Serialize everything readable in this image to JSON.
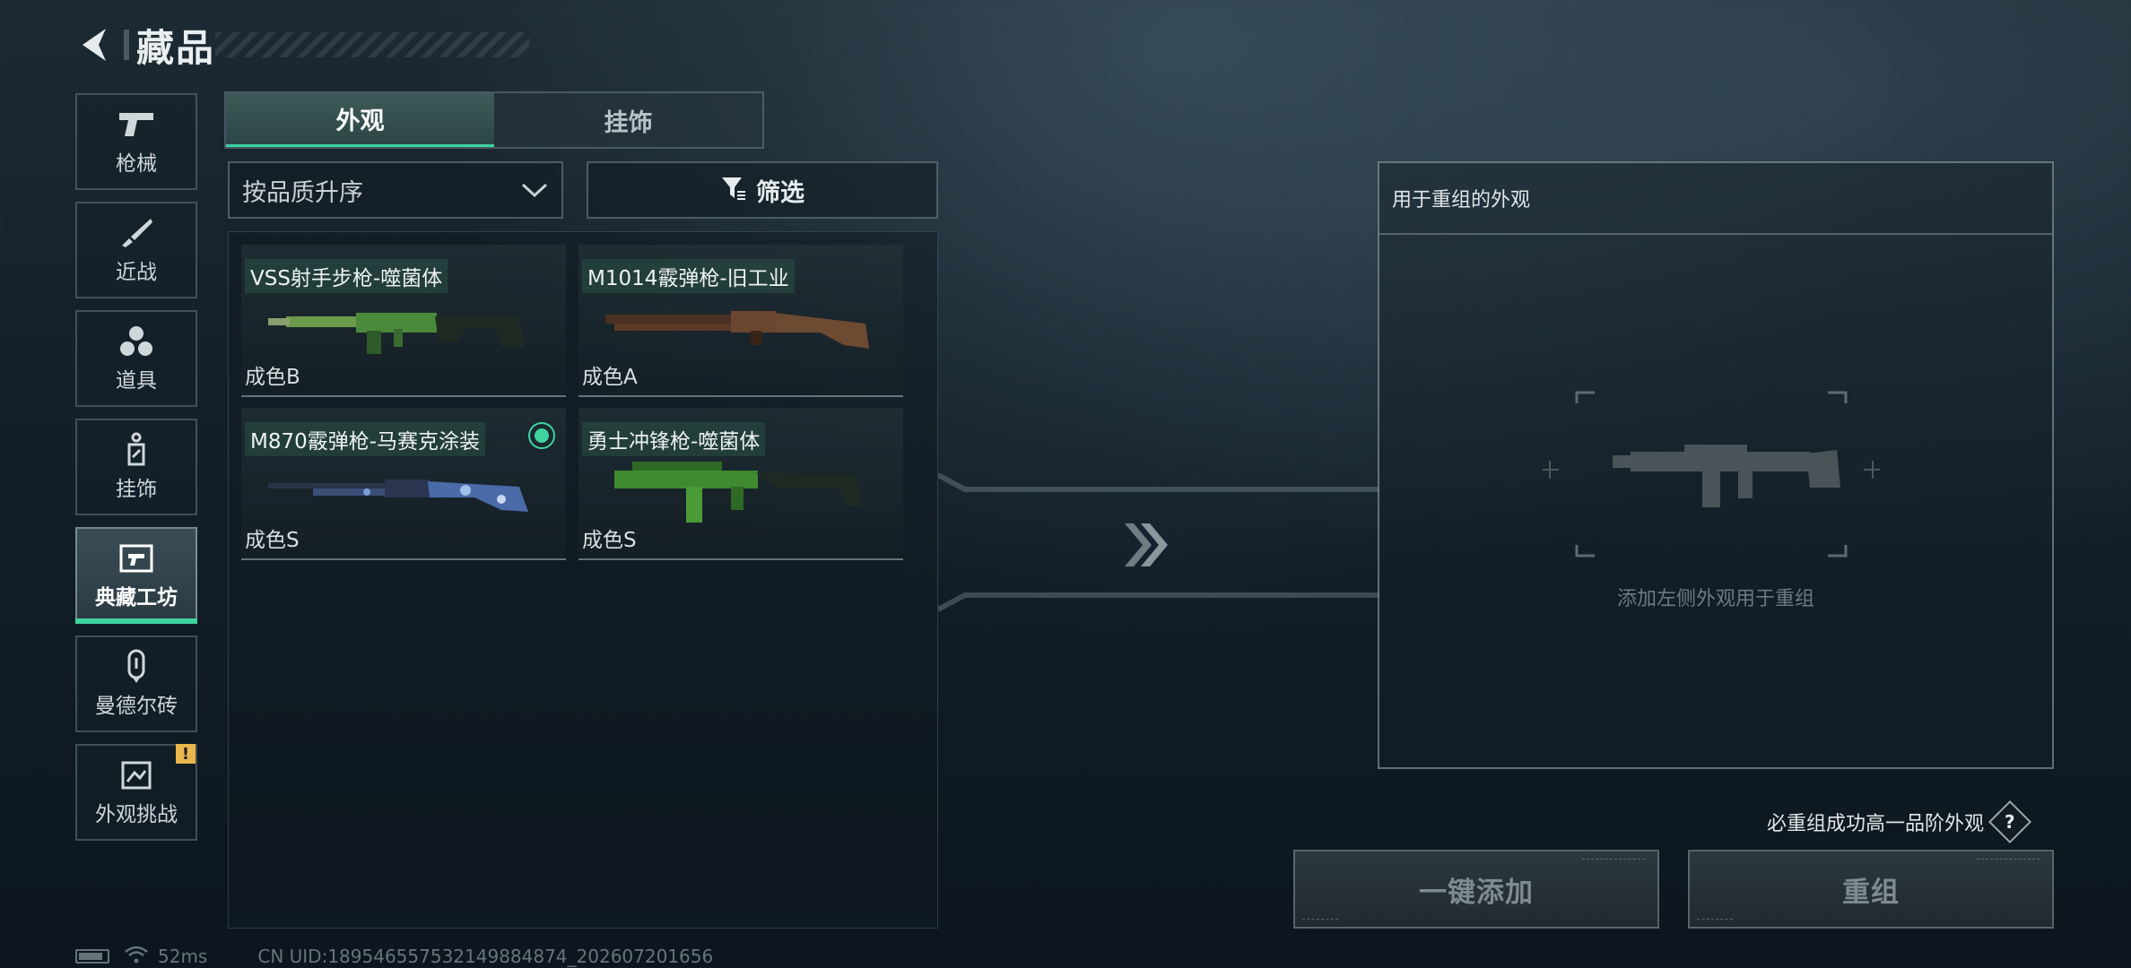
{
  "header": {
    "title": "藏品"
  },
  "sidebar": {
    "items": [
      {
        "label": "枪械",
        "icon": "pistol-icon"
      },
      {
        "label": "近战",
        "icon": "knife-icon"
      },
      {
        "label": "道具",
        "icon": "grenade-cluster-icon"
      },
      {
        "label": "挂饰",
        "icon": "charm-tag-icon"
      },
      {
        "label": "典藏工坊",
        "icon": "workshop-icon",
        "active": true
      },
      {
        "label": "曼德尔砖",
        "icon": "mandel-brick-icon"
      },
      {
        "label": "外观挑战",
        "icon": "skin-challenge-icon",
        "badge": "!"
      }
    ]
  },
  "tabs": [
    {
      "label": "外观",
      "active": true
    },
    {
      "label": "挂饰",
      "active": false
    }
  ],
  "sort": {
    "value": "按品质升序"
  },
  "filter": {
    "label": "筛选"
  },
  "items": [
    {
      "name": "VSS射手步枪-噬菌体",
      "grade": "成色B",
      "color": "#4a8a3a",
      "selected": false
    },
    {
      "name": "M1014霰弹枪-旧工业",
      "grade": "成色A",
      "color": "#5b3a28",
      "selected": false
    },
    {
      "name": "M870霰弹枪-马赛克涂装",
      "grade": "成色S",
      "color": "#3a4e78",
      "selected": true
    },
    {
      "name": "勇士冲锋枪-噬菌体",
      "grade": "成色S",
      "color": "#3f8a2f",
      "selected": false
    }
  ],
  "recombine": {
    "header": "用于重组的外观",
    "placeholder": "添加左侧外观用于重组"
  },
  "hint": {
    "text": "必重组成功高一品阶外观",
    "help": "?"
  },
  "buttons": {
    "add_all": "一键添加",
    "recombine": "重组"
  },
  "status": {
    "ping": "52ms",
    "uid": "CN UID:18954655753214988487​4_202607201656"
  },
  "colors": {
    "accent": "#3fd3a0",
    "warning": "#e8b64a"
  }
}
